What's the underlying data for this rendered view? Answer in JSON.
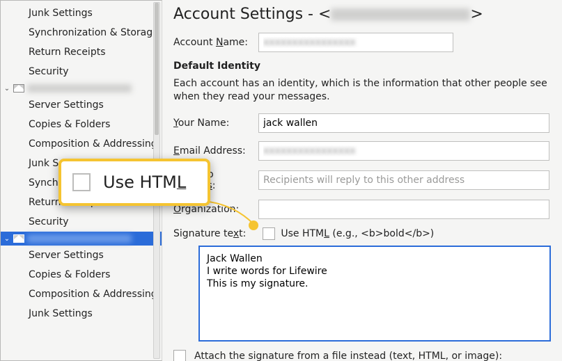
{
  "sidebar": {
    "acct1": {
      "items": [
        "Junk Settings",
        "Synchronization & Storage",
        "Return Receipts",
        "Security"
      ]
    },
    "acct2": {
      "items": [
        "Server Settings",
        "Copies & Folders",
        "Composition & Addressing",
        "Junk Settings",
        "Synchronization & Storage",
        "Return Receipts",
        "Security"
      ]
    },
    "acct3": {
      "items": [
        "Server Settings",
        "Copies & Folders",
        "Composition & Addressing",
        "Junk Settings"
      ]
    }
  },
  "title_prefix": "Account Settings - ",
  "account_name_label": "Account Name:",
  "account_name_label_u": "N",
  "default_identity": "Default Identity",
  "identity_note": "Each account has an identity, which is the information that other people see when they read your messages.",
  "fields": {
    "your_name": {
      "label": "Your Name:",
      "u": "Y",
      "value": "jack wallen"
    },
    "email": {
      "label": "Email Address:",
      "u": "E"
    },
    "reply": {
      "label": "Reply-to Address:",
      "u": "s",
      "placeholder": "Recipients will reply to this other address"
    },
    "org": {
      "label": "Organization:",
      "u": "O"
    }
  },
  "signature": {
    "label_pre": "Signature te",
    "label_u": "x",
    "label_post": "t:",
    "use_html_pre": "Use HTM",
    "use_html_u": "L",
    "use_html_hint": " (e.g., <b>bold</b>)",
    "text": "Jack Wallen\nI write words for Lifewire\nThis is my signature."
  },
  "attach_label": "Attach the signature from a file instead (text, HTML, or image):",
  "callout": {
    "label_pre": "Use HTM",
    "label_u": "L"
  }
}
